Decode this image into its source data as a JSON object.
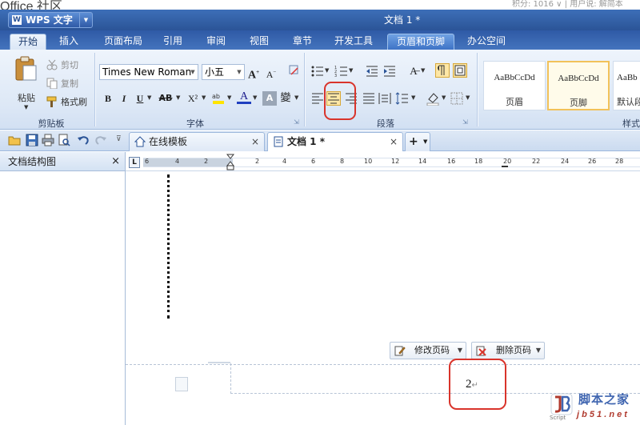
{
  "top_strip": {
    "left_text": "Office  社区",
    "right_text": "积分: 1016 ∨  |  用户说: 解简本"
  },
  "window": {
    "app_button": "WPS 文字",
    "doc_title": "文档 1 *"
  },
  "tabs": [
    {
      "label": "开始",
      "active": true
    },
    {
      "label": "插入"
    },
    {
      "label": "页面布局"
    },
    {
      "label": "引用"
    },
    {
      "label": "审阅"
    },
    {
      "label": "视图"
    },
    {
      "label": "章节"
    },
    {
      "label": "开发工具"
    },
    {
      "label": "页眉和页脚",
      "highlighted": true
    },
    {
      "label": "办公空间"
    }
  ],
  "clipboard": {
    "paste": "粘贴",
    "cut": "剪切",
    "copy": "复制",
    "format_painter": "格式刷",
    "group_label": "剪贴板"
  },
  "font": {
    "family": "Times New Roman",
    "size": "小五",
    "group_label": "字体",
    "bold": "B",
    "italic": "I",
    "underline": "U",
    "strike": "AB",
    "superscript": "X²",
    "font_color": "A"
  },
  "paragraph": {
    "group_label": "段落"
  },
  "styles": {
    "group_label": "样式",
    "cards": [
      {
        "sample": "AaBbCcDd",
        "name": "页眉"
      },
      {
        "sample": "AaBbCcDd",
        "name": "页脚",
        "selected": true
      },
      {
        "sample": "AaBb",
        "name": "默认段"
      }
    ]
  },
  "doc_tabs": [
    {
      "label": "在线模板",
      "close": "×"
    },
    {
      "label": "文档 1 *",
      "close": "×",
      "active": true
    }
  ],
  "new_tab": "+",
  "side_panel": {
    "title": "文档结构图",
    "close": "×"
  },
  "ruler": {
    "corner": "L",
    "numbers": [
      "6",
      "4",
      "2",
      "2",
      "4",
      "6",
      "8",
      "10",
      "12",
      "14",
      "16",
      "18",
      "20",
      "22",
      "24",
      "26",
      "28"
    ]
  },
  "footer_toolbar": {
    "edit_page_number": "修改页码",
    "delete_page_number": "删除页码"
  },
  "page_number": "2",
  "watermark": {
    "name": "脚本之家",
    "domain": "j b 5 1 . n e t",
    "tag": "Script"
  },
  "colors": {
    "accent": "#2b5497",
    "highlight_red": "#d9342b",
    "selected_style": "#f2c25a"
  }
}
